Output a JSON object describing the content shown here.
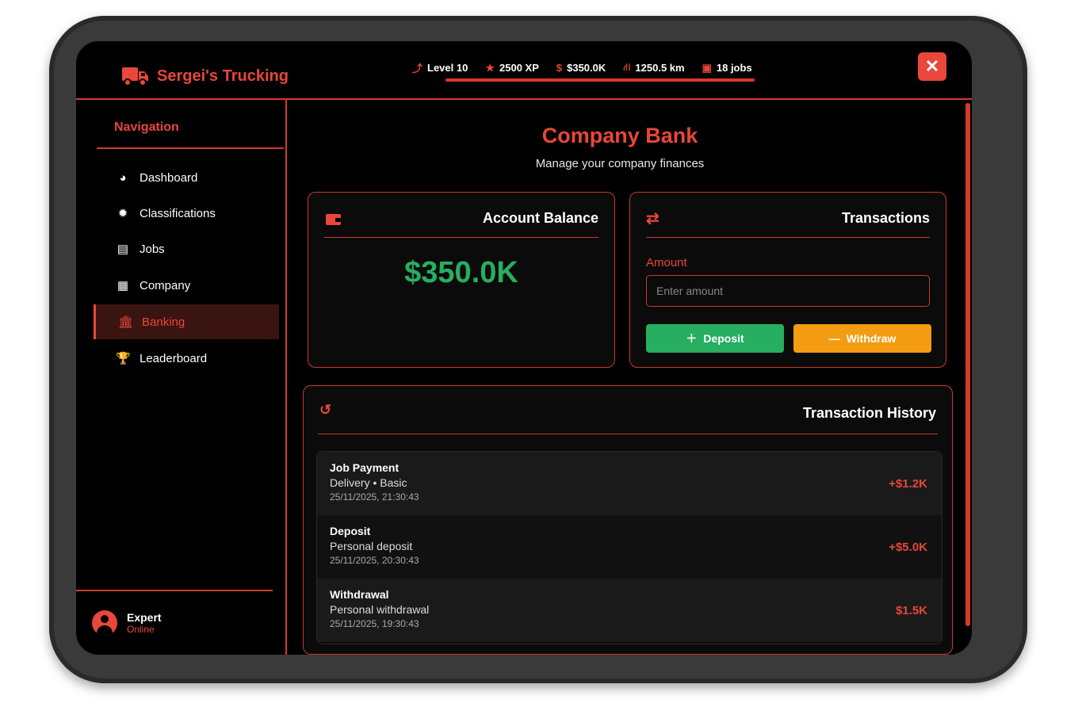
{
  "app": {
    "brand_name": "Sergei's Trucking",
    "close_label": "✕"
  },
  "stats": {
    "level": "Level 10",
    "xp": "2500 XP",
    "money": "$350.0K",
    "distance": "1250.5 km",
    "jobs": "18 jobs"
  },
  "sidebar": {
    "title": "Navigation",
    "items": [
      {
        "label": "Dashboard",
        "icon": "gauge-icon"
      },
      {
        "label": "Classifications",
        "icon": "badge-icon"
      },
      {
        "label": "Jobs",
        "icon": "clipboard-icon"
      },
      {
        "label": "Company",
        "icon": "building-icon"
      },
      {
        "label": "Banking",
        "icon": "bank-icon",
        "active": true
      },
      {
        "label": "Leaderboard",
        "icon": "trophy-icon"
      }
    ],
    "user": {
      "name": "Expert",
      "status": "Online"
    }
  },
  "main": {
    "title": "Company Bank",
    "subtitle": "Manage your company finances",
    "balance_card": {
      "title": "Account Balance",
      "amount": "$350.0K"
    },
    "transactions_card": {
      "title": "Transactions",
      "amount_label": "Amount",
      "amount_placeholder": "Enter amount",
      "deposit_label": "Deposit",
      "withdraw_label": "Withdraw"
    },
    "history": {
      "title": "Transaction History",
      "rows": [
        {
          "title": "Job Payment",
          "desc": "Delivery • Basic",
          "date": "25/11/2025, 21:30:43",
          "amount": "+$1.2K"
        },
        {
          "title": "Deposit",
          "desc": "Personal deposit",
          "date": "25/11/2025, 20:30:43",
          "amount": "+$5.0K"
        },
        {
          "title": "Withdrawal",
          "desc": "Personal withdrawal",
          "date": "25/11/2025, 19:30:43",
          "amount": "$1.5K"
        }
      ]
    }
  },
  "colors": {
    "accent": "#e8473a",
    "success": "#27ae60",
    "warning": "#f39c12",
    "background": "#000000"
  }
}
